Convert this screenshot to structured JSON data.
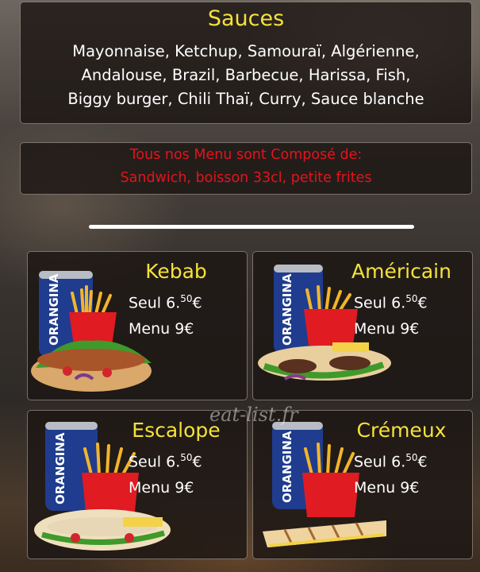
{
  "sauces": {
    "title": "Sauces",
    "lines": [
      "Mayonnaise, Ketchup, Samouraï, Algérienne,",
      "Andalouse, Brazil, Barbecue, Harissa, Fish,",
      "Biggy burger, Chili Thaï, Curry, Sauce blanche"
    ]
  },
  "menu_info": {
    "lines": [
      "Tous nos Menu sont Composé de:",
      "Sandwich, boisson 33cl, petite frites"
    ]
  },
  "products": [
    {
      "name": "Kebab",
      "seul_label": "Seul 6.",
      "seul_cents": "50",
      "seul_currency": "€",
      "menu_price": "Menu 9€",
      "can_brand": "ORANGINA"
    },
    {
      "name": "Américain",
      "seul_label": "Seul 6.",
      "seul_cents": "50",
      "seul_currency": "€",
      "menu_price": "Menu 9€",
      "can_brand": "ORANGINA"
    },
    {
      "name": "Escalope",
      "seul_label": "Seul 6.",
      "seul_cents": "50",
      "seul_currency": "€",
      "menu_price": "Menu 9€",
      "can_brand": "ORANGINA"
    },
    {
      "name": "Crémeux",
      "seul_label": "Seul 6.",
      "seul_cents": "50",
      "seul_currency": "€",
      "menu_price": "Menu 9€",
      "can_brand": "ORANGINA"
    }
  ],
  "watermark": "eat-list.fr",
  "colors": {
    "title_yellow": "#f5e23a",
    "info_red": "#e3141b",
    "panel_bg": "#1c1614",
    "can_blue": "#1f3c8f",
    "fries_box_red": "#e01b22",
    "fries_yellow": "#f2b52a"
  }
}
